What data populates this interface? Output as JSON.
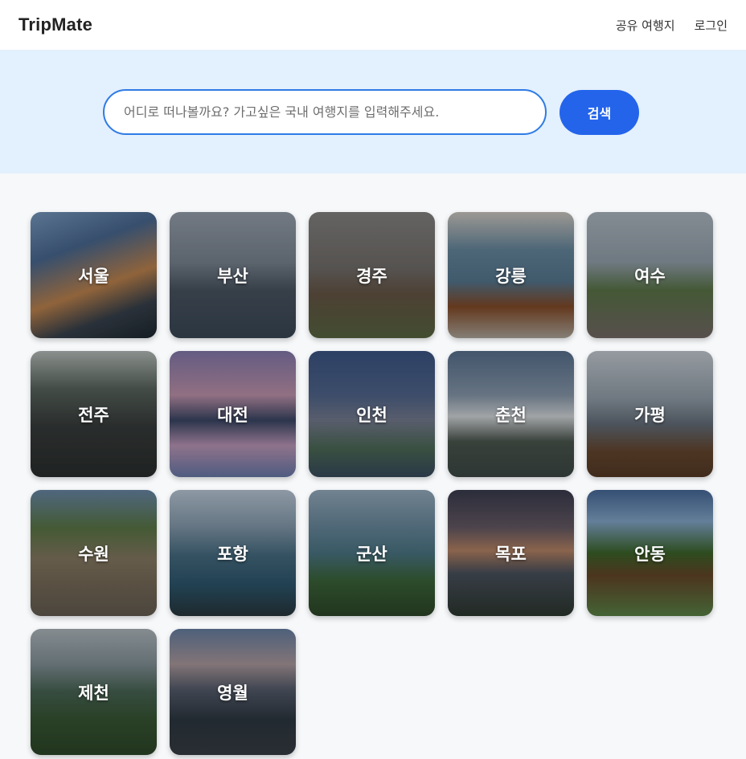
{
  "header": {
    "logo": "TripMate",
    "nav": [
      {
        "label": "공유 여행지"
      },
      {
        "label": "로그인"
      }
    ]
  },
  "search": {
    "placeholder": "어디로 떠나볼까요? 가고싶은 국내 여행지를 입력해주세요.",
    "value": "",
    "button_label": "검색"
  },
  "colors": {
    "accent": "#2364eb",
    "input_border": "#2f7be5",
    "hero_bg": "#e3f0fd",
    "page_bg": "#f6f8fa"
  },
  "destinations": [
    {
      "name": "서울",
      "bg": "linear-gradient(160deg,#7da1c9 0%,#4d6e98 30%,#c78a52 58%,#3a4450 78%,#1f2a33 100%)"
    },
    {
      "name": "부산",
      "bg": "linear-gradient(180deg,#9fa9b6 0%,#7f8a97 40%,#4d5866 62%,#3c4b5a 100%)"
    },
    {
      "name": "경주",
      "bg": "linear-gradient(180deg,#8c8a88 0%,#777370 45%,#6b5a48 65%,#5d6b45 100%)"
    },
    {
      "name": "강릉",
      "bg": "linear-gradient(180deg,#d9d4cc 0%,#6b8ea6 30%,#5a7d96 55%,#8a4f2a 75%,#b8b0a4 100%)"
    },
    {
      "name": "여수",
      "bg": "linear-gradient(180deg,#b7c2cc 0%,#9aa8b3 40%,#5f7b4b 62%,#7a6f6b 100%)"
    },
    {
      "name": "전주",
      "bg": "linear-gradient(180deg,#bfc8c4 0%,#5e6a62 30%,#3a3f3e 60%,#2c302f 100%)"
    },
    {
      "name": "대전",
      "bg": "linear-gradient(180deg,#8b7fb5 0%,#c99bb5 35%,#3d4a6a 55%,#c6a0c2 75%,#6e7fb2 100%)"
    },
    {
      "name": "인천",
      "bg": "linear-gradient(180deg,#3e5a8c 0%,#556b94 35%,#7b8296 55%,#4f6f5a 78%,#3b4f63 100%)"
    },
    {
      "name": "춘천",
      "bg": "linear-gradient(180deg,#5d7796 0%,#8ea0b4 35%,#dfe3e6 52%,#4f5a52 72%,#3f4c48 100%)"
    },
    {
      "name": "가평",
      "bg": "linear-gradient(180deg,#cfd7de 0%,#9aa7b2 38%,#6a7480 58%,#6b4a30 80%,#5a3d28 100%)"
    },
    {
      "name": "수원",
      "bg": "linear-gradient(180deg,#6f8fb0 0%,#5f7d4a 30%,#8d7f67 55%,#7a6e5c 78%,#6a6256 100%)"
    },
    {
      "name": "포항",
      "bg": "linear-gradient(180deg,#c4d4e3 0%,#8fa5b8 28%,#4a7288 52%,#2f5b73 75%,#2a3a40 100%)"
    },
    {
      "name": "군산",
      "bg": "linear-gradient(180deg,#9eb5c8 0%,#6d8fa4 30%,#4f7c8c 50%,#3e6a3c 72%,#2f4a2a 100%)"
    },
    {
      "name": "목포",
      "bg": "linear-gradient(180deg,#3d3f52 0%,#6b5f6a 30%,#c08a6a 48%,#4e5662 66%,#2f3a32 100%)"
    },
    {
      "name": "안동",
      "bg": "linear-gradient(180deg,#4b6fa2 0%,#8ab0d4 25%,#3f6a2c 50%,#6a4a2a 68%,#5f8a4a 100%)"
    },
    {
      "name": "제천",
      "bg": "linear-gradient(180deg,#b8c2c8 0%,#8a9aa0 28%,#4c6a58 50%,#3a5a36 72%,#2f4a2a 100%)"
    },
    {
      "name": "영월",
      "bg": "linear-gradient(180deg,#6d86aa 0%,#b5a2a6 28%,#5a6272 48%,#2f3a44 72%,#3a4048 100%)"
    }
  ]
}
